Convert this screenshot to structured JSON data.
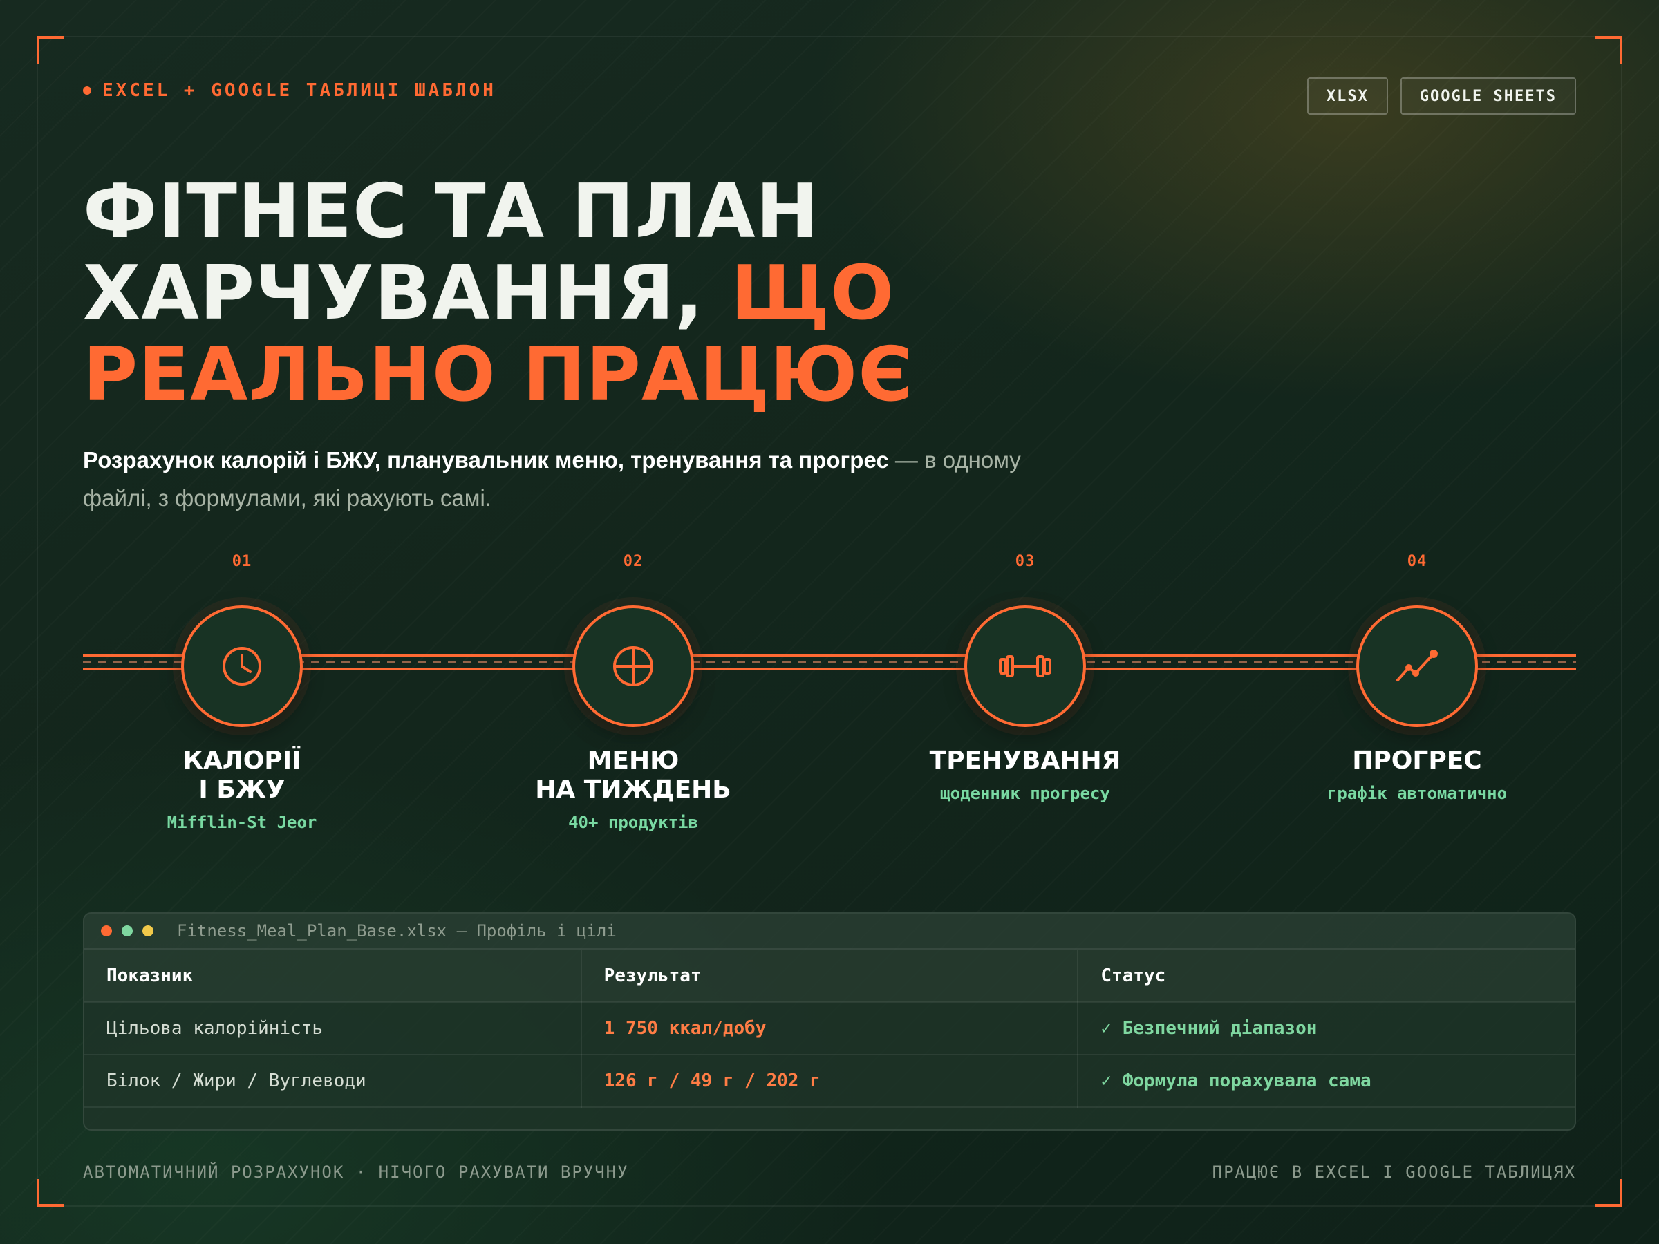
{
  "header": {
    "eyebrow": "EXCEL + GOOGLE ТАБЛИЦІ ШАБЛОН",
    "badges": [
      "XLSX",
      "GOOGLE SHEETS"
    ]
  },
  "hero": {
    "title_line1": "ФІТНЕС ТА ПЛАН",
    "title_line2_plain": "ХАРЧУВАННЯ, ",
    "title_line2_accent": "ЩО",
    "title_line3_accent": "РЕАЛЬНО ПРАЦЮЄ",
    "subtitle_bold": "Розрахунок калорій і БЖУ, планувальник меню, тренування та прогрес",
    "subtitle_rest": " — в одному файлі, з формулами, які рахують самі."
  },
  "steps": [
    {
      "num": "01",
      "title_line1": "КАЛОРІЇ",
      "title_line2": "І БЖУ",
      "sub": "Mifflin-St Jeor",
      "icon": "clock-icon"
    },
    {
      "num": "02",
      "title_line1": "МЕНЮ",
      "title_line2": "НА ТИЖДЕНЬ",
      "sub": "40+ продуктів",
      "icon": "crosshair-icon"
    },
    {
      "num": "03",
      "title_line1": "ТРЕНУВАННЯ",
      "title_line2": "",
      "sub": "щоденник прогресу",
      "icon": "dumbbell-icon"
    },
    {
      "num": "04",
      "title_line1": "ПРОГРЕС",
      "title_line2": "",
      "sub": "графік автоматично",
      "icon": "trend-line-icon"
    }
  ],
  "window": {
    "filename": "Fitness_Meal_Plan_Base.xlsx — Профіль і цілі",
    "columns": [
      "Показник",
      "Результат",
      "Статус"
    ],
    "rows": [
      {
        "label": "Цільова калорійність",
        "value": "1 750 ккал/добу",
        "status": "✓ Безпечний діапазон"
      },
      {
        "label": "Білок / Жири / Вуглеводи",
        "value": "126 г / 49 г / 202 г",
        "status": "✓ Формула порахувала сама"
      }
    ]
  },
  "footer": {
    "left": "АВТОМАТИЧНИЙ РОЗРАХУНОК · НІЧОГО РАХУВАТИ ВРУЧНУ",
    "right": "ПРАЦЮЄ В EXCEL І GOOGLE ТАБЛИЦЯХ"
  },
  "colors": {
    "accent": "#ff6a33",
    "success": "#7fd7a0",
    "background": "#13261c"
  }
}
